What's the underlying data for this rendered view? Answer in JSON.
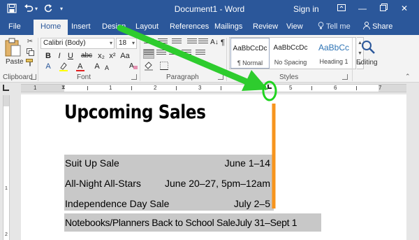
{
  "titlebar": {
    "quick_access": {
      "save_icon": "save-icon",
      "undo_icon": "undo-icon",
      "redo_icon": "redo-icon",
      "customize_icon": "chevron-down-icon"
    },
    "document_title": "Document1 - Word",
    "signin": "Sign in",
    "window_controls": {
      "ribbon_display_icon": "ribbon-display-icon",
      "minimize_icon": "minimize-icon",
      "restore_icon": "restore-icon",
      "close_icon": "close-icon"
    }
  },
  "tabs": [
    {
      "label": "File"
    },
    {
      "label": "Home",
      "active": true
    },
    {
      "label": "Insert"
    },
    {
      "label": "Design"
    },
    {
      "label": "Layout"
    },
    {
      "label": "References"
    },
    {
      "label": "Mailings"
    },
    {
      "label": "Review"
    },
    {
      "label": "View"
    }
  ],
  "tell_me": "Tell me",
  "share": "Share",
  "ribbon": {
    "clipboard": {
      "paste_label": "Paste",
      "group_label": "Clipboard"
    },
    "font": {
      "font_name": "Calibri (Body)",
      "font_size": "18",
      "bold": "B",
      "italic": "I",
      "underline": "U",
      "strike": "abc",
      "subscript": "x₂",
      "superscript": "x²",
      "group_label": "Font"
    },
    "paragraph": {
      "group_label": "Paragraph"
    },
    "styles": {
      "group_label": "Styles",
      "items": [
        {
          "sample": "AaBbCcDc",
          "name": "¶ Normal",
          "selected": true
        },
        {
          "sample": "AaBbCcDc",
          "name": "No Spacing",
          "selected": false
        },
        {
          "sample": "AaBbCc",
          "name": "Heading 1",
          "selected": false
        }
      ]
    },
    "editing": {
      "label": "Editing"
    }
  },
  "ruler": {
    "numbers": [
      "1",
      "1",
      "2",
      "3",
      "4",
      "5",
      "6",
      "7"
    ]
  },
  "vertical_ruler": {
    "numbers": [
      "1",
      "2"
    ]
  },
  "document": {
    "heading": "Upcoming Sales",
    "lines": [
      {
        "name": "Suit Up Sale",
        "date": "June 1–14"
      },
      {
        "name": "All-Night All-Stars",
        "date": "June 20–27, 5pm–12am"
      },
      {
        "name": "Independence Day Sale",
        "date": "July 2–5"
      },
      {
        "name": "Notebooks/Planners Back to School Sale",
        "date": "July 31–Sept 1"
      }
    ]
  },
  "annotations": {
    "arrow_color": "#2ecc2e",
    "circle_color": "#1fd31f",
    "tab_line_color": "#f7941d"
  }
}
